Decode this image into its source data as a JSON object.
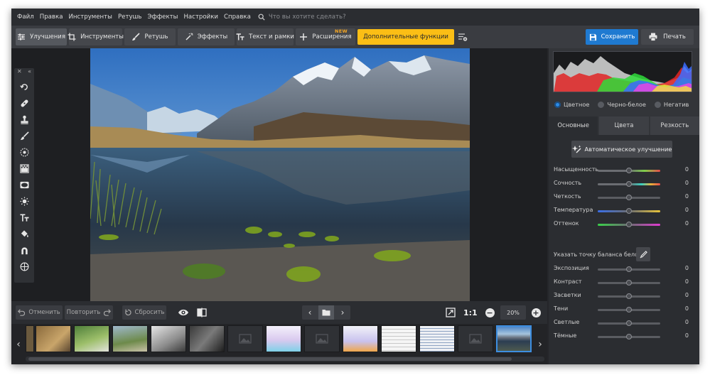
{
  "menu": [
    "Файл",
    "Правка",
    "Инструменты",
    "Ретушь",
    "Эффекты",
    "Настройки",
    "Справка"
  ],
  "search": {
    "placeholder": "Что вы хотите сделать?"
  },
  "toolbar": {
    "tabs": [
      {
        "label": "Улучшения",
        "icon": "sliders-icon"
      },
      {
        "label": "Инструменты",
        "icon": "crop-icon"
      },
      {
        "label": "Ретушь",
        "icon": "brush-icon"
      },
      {
        "label": "Эффекты",
        "icon": "magic-wand-icon"
      },
      {
        "label": "Текст и рамки",
        "icon": "text-icon"
      },
      {
        "label": "Расширения",
        "icon": "plus-icon"
      }
    ],
    "new_badge": "NEW",
    "extra_label": "Дополнительные функции",
    "save_label": "Сохранить",
    "print_label": "Печать"
  },
  "bottom_bar": {
    "undo_label": "Отменить",
    "redo_label": "Повторить",
    "reset_label": "Сбросить",
    "ratio_label": "1:1",
    "zoom": "20%"
  },
  "panel": {
    "modes": [
      "Цветное",
      "Черно-белое",
      "Негатив"
    ],
    "selected_mode": "Цветное",
    "tabs": [
      "Основные",
      "Цвета",
      "Резкость"
    ],
    "active_tab": "Основные",
    "auto_label": "Автоматическое улучшение",
    "white_balance_label": "Указать точку баланса белого",
    "sliders": [
      {
        "label": "Насыщенность",
        "value": "0"
      },
      {
        "label": "Сочность",
        "value": "0"
      },
      {
        "label": "Четкость",
        "value": "0"
      },
      {
        "label": "Температура",
        "value": "0"
      },
      {
        "label": "Оттенок",
        "value": "0"
      },
      {
        "label": "Экспозиция",
        "value": "0"
      },
      {
        "label": "Контраст",
        "value": "0"
      },
      {
        "label": "Засветки",
        "value": "0"
      },
      {
        "label": "Тени",
        "value": "0"
      },
      {
        "label": "Светлые",
        "value": "0"
      },
      {
        "label": "Тёмные",
        "value": "0"
      }
    ]
  },
  "colors": {
    "accent": "#fbbe15",
    "save": "#1f7ad1",
    "selected_radio": "#2b8be6"
  }
}
